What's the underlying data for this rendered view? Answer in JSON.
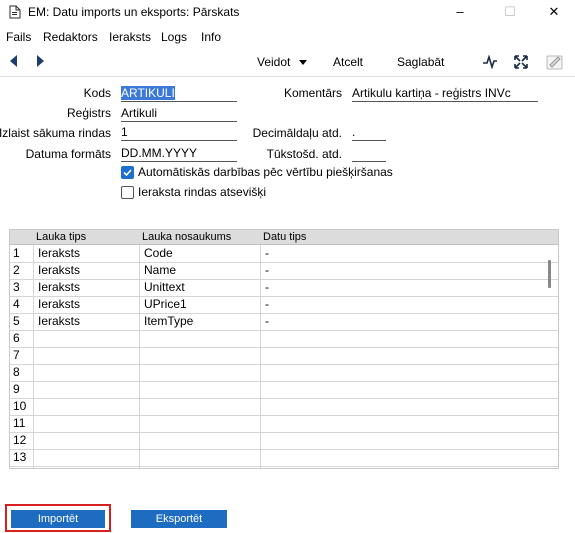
{
  "window": {
    "title": "EM: Datu imports un eksports: Pārskats",
    "minimize": "–",
    "maximize": "☐",
    "close": "✕"
  },
  "menu": [
    "Fails",
    "Redaktors",
    "Ieraksts",
    "Logs",
    "Info"
  ],
  "toolbar": {
    "veidot_label": "Veidot",
    "atcelt_label": "Atcelt",
    "saglabat_label": "Saglabāt"
  },
  "form": {
    "kods_label": "Kods",
    "kods_value": "ARTIKULI",
    "registrs_label": "Reģistrs",
    "registrs_value": "Artikuli",
    "izlaist_label": "Izlaist sākuma rindas",
    "izlaist_value": "1",
    "datuma_label": "Datuma formāts",
    "datuma_value": "DD.MM.YYYY",
    "komentars_label": "Komentārs",
    "komentars_value": "Artikulu kartiņa - reģistrs INVc",
    "decimal_label": "Decimāldaļu atd.",
    "decimal_value": ".",
    "tukstosd_label": "Tūkstošd. atd.",
    "tukstosd_value": "",
    "auto_label": "Automātiskās darbības pēc vērtību piešķiršanas",
    "auto_checked": true,
    "ieraksta_label": "Ieraksta rindas atsevišķi",
    "ieraksta_checked": false
  },
  "grid": {
    "headers": [
      "Lauka tips",
      "Lauka nosaukums",
      "Datu tips"
    ],
    "rows": [
      {
        "n": "1",
        "tips": "Ieraksts",
        "nosaukums": "Code",
        "datu": "-"
      },
      {
        "n": "2",
        "tips": "Ieraksts",
        "nosaukums": "Name",
        "datu": "-"
      },
      {
        "n": "3",
        "tips": "Ieraksts",
        "nosaukums": "Unittext",
        "datu": "-"
      },
      {
        "n": "4",
        "tips": "Ieraksts",
        "nosaukums": "UPrice1",
        "datu": "-"
      },
      {
        "n": "5",
        "tips": "Ieraksts",
        "nosaukums": "ItemType",
        "datu": "-"
      },
      {
        "n": "6",
        "tips": "",
        "nosaukums": "",
        "datu": ""
      },
      {
        "n": "7",
        "tips": "",
        "nosaukums": "",
        "datu": ""
      },
      {
        "n": "8",
        "tips": "",
        "nosaukums": "",
        "datu": ""
      },
      {
        "n": "9",
        "tips": "",
        "nosaukums": "",
        "datu": ""
      },
      {
        "n": "10",
        "tips": "",
        "nosaukums": "",
        "datu": ""
      },
      {
        "n": "11",
        "tips": "",
        "nosaukums": "",
        "datu": ""
      },
      {
        "n": "12",
        "tips": "",
        "nosaukums": "",
        "datu": ""
      },
      {
        "n": "13",
        "tips": "",
        "nosaukums": "",
        "datu": ""
      }
    ]
  },
  "buttons": {
    "importet": "Importēt",
    "eksportet": "Eksportēt"
  },
  "colors": {
    "button_blue": "#1e6bc2",
    "highlight_red": "#d62020",
    "selection_blue": "#3b78d8"
  }
}
